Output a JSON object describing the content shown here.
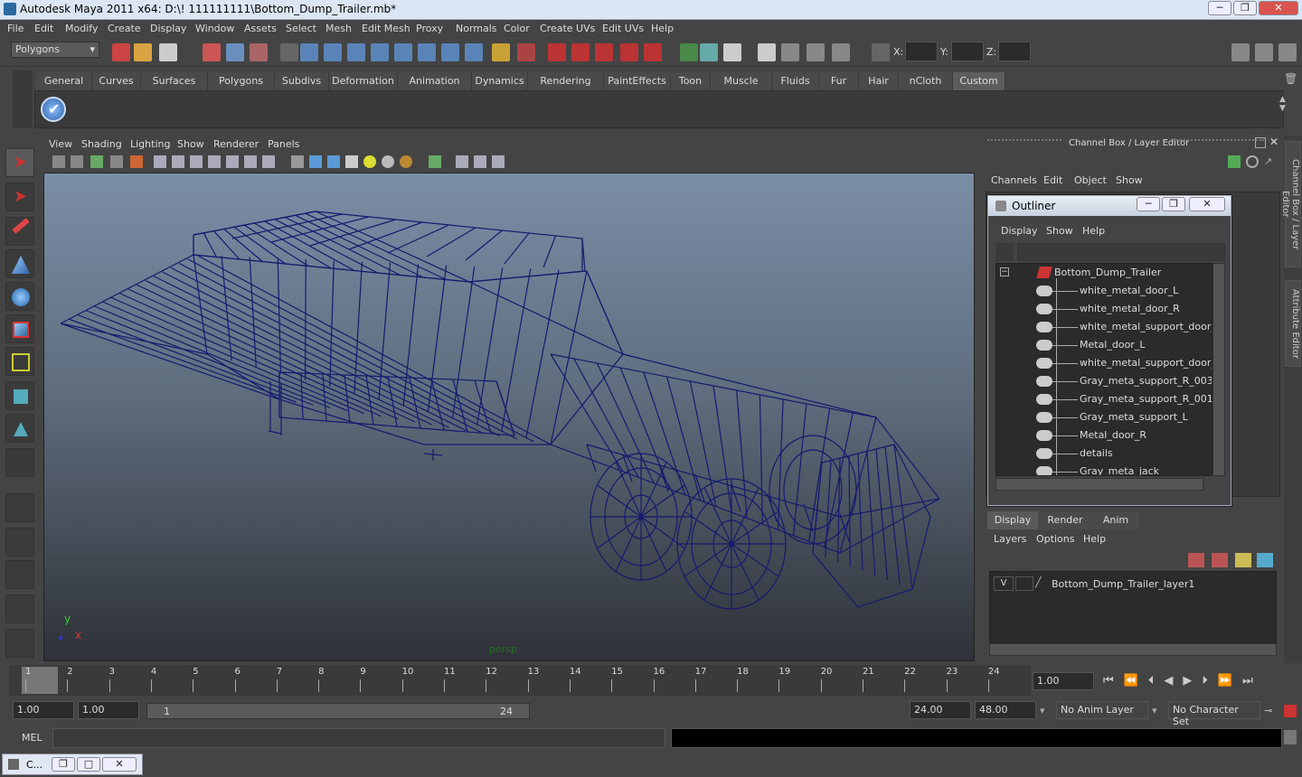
{
  "window": {
    "title": "Autodesk Maya 2011 x64: D:\\! 111111111\\Bottom_Dump_Trailer.mb*"
  },
  "menus": [
    "File",
    "Edit",
    "Modify",
    "Create",
    "Display",
    "Window",
    "Assets",
    "Select",
    "Mesh",
    "Edit Mesh",
    "Proxy",
    "Normals",
    "Color",
    "Create UVs",
    "Edit UVs",
    "Help"
  ],
  "status": {
    "mode": "Polygons",
    "x_label": "X:",
    "y_label": "Y:",
    "z_label": "Z:"
  },
  "shelf_tabs": [
    "General",
    "Curves",
    "Surfaces",
    "Polygons",
    "Subdivs",
    "Deformation",
    "Animation",
    "Dynamics",
    "Rendering",
    "PaintEffects",
    "Toon",
    "Muscle",
    "Fluids",
    "Fur",
    "Hair",
    "nCloth",
    "Custom"
  ],
  "active_shelf": "Custom",
  "panel_menus": [
    "View",
    "Shading",
    "Lighting",
    "Show",
    "Renderer",
    "Panels"
  ],
  "viewport": {
    "camera": "persp",
    "axis_y": "y",
    "axis_x": "x",
    "wire_color": "#151a6e"
  },
  "channel_box": {
    "title": "Channel Box / Layer Editor",
    "menus": [
      "Channels",
      "Edit",
      "Object",
      "Show"
    ]
  },
  "outliner": {
    "title": "Outliner",
    "menus": [
      "Display",
      "Show",
      "Help"
    ],
    "root": "Bottom_Dump_Trailer",
    "items": [
      "white_metal_door_L",
      "white_metal_door_R",
      "white_metal_support_door_L_",
      "Metal_door_L",
      "white_metal_support_door_L_",
      "Gray_meta_support_R_003",
      "Gray_meta_support_R_001",
      "Gray_meta_support_L",
      "Metal_door_R",
      "details",
      "Gray_meta_jack"
    ]
  },
  "layer_editor": {
    "tabs": [
      "Display",
      "Render",
      "Anim"
    ],
    "menus": [
      "Layers",
      "Options",
      "Help"
    ],
    "layer_visible": "V",
    "layer_name": "Bottom_Dump_Trailer_layer1"
  },
  "side_tabs": [
    "Channel Box / Layer Editor",
    "Attribute Editor"
  ],
  "timeline": {
    "ticks": [
      "1",
      "2",
      "3",
      "4",
      "5",
      "6",
      "7",
      "8",
      "9",
      "10",
      "11",
      "12",
      "13",
      "14",
      "15",
      "16",
      "17",
      "18",
      "19",
      "20",
      "21",
      "22",
      "23",
      "24"
    ],
    "current_frame": "1.00"
  },
  "range": {
    "start": "1.00",
    "start2": "1.00",
    "slider_start": "1",
    "slider_end": "24",
    "end": "24.00",
    "end2": "48.00",
    "anim_layer": "No Anim Layer",
    "char_set": "No Character Set"
  },
  "cmd": {
    "label": "MEL"
  },
  "taskbar": {
    "label": "C..."
  }
}
